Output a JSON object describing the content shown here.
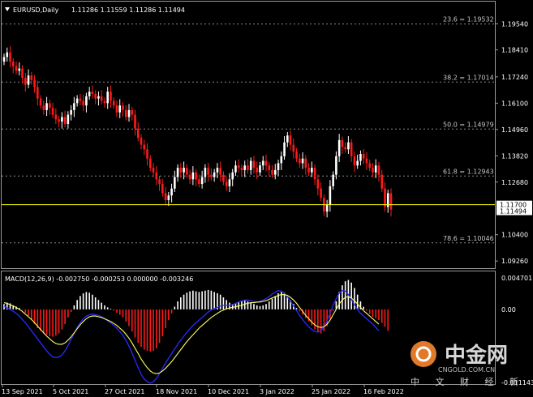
{
  "header": {
    "symbol": "EURUSD,Daily",
    "ohlc": "1.11286 1.11559 1.11286 1.11494"
  },
  "macd": {
    "label": "MACD(12,26,9) -0.002750 -0.000253 0.000000 -0.003246",
    "ticks": [
      "0.004701",
      "0.00",
      "-0.011143"
    ]
  },
  "watermark": {
    "brand": "中金网",
    "domain": "CNGOLD.COM.CN",
    "tagline": "中 文 财 经 新 媒"
  },
  "colors": {
    "background": "#000000",
    "bull": "#ffffff",
    "bear": "#ff1a1a",
    "macd_line": "#2a2aff",
    "signal_line": "#ffff66",
    "grid_level": "#8a8a8a",
    "current_price_line": "#ffff00"
  },
  "chart_data": {
    "type": "candlestick",
    "price_axis": {
      "ticks": [
        "1.19540",
        "1.18410",
        "1.17240",
        "1.16100",
        "1.14960",
        "1.13820",
        "1.12680",
        "1.10400",
        "1.09260"
      ],
      "ylim": [
        1.0895,
        1.205
      ]
    },
    "current_price": {
      "value": 1.11494,
      "label": "1.11494"
    },
    "marker_price": {
      "value": 1.117,
      "label": "1.11700"
    },
    "fibonacci_levels": [
      {
        "label": "23.6 = 1.19532",
        "value": 1.19532
      },
      {
        "label": "38.2 = 1.17014",
        "value": 1.17014
      },
      {
        "label": "50.0 = 1.14979",
        "value": 1.14979
      },
      {
        "label": "61.8 = 1.12943",
        "value": 1.12943
      },
      {
        "label": "78.6 = 1.10046",
        "value": 1.10046
      }
    ],
    "x_labels": [
      "13 Sep 2021",
      "5 Oct 2021",
      "27 Oct 2021",
      "18 Nov 2021",
      "10 Dec 2021",
      "3 Jan 2022",
      "25 Jan 2022",
      "16 Feb 2022"
    ],
    "closes": [
      1.181,
      1.183,
      1.179,
      1.177,
      1.175,
      1.176,
      1.172,
      1.169,
      1.173,
      1.171,
      1.168,
      1.163,
      1.16,
      1.158,
      1.161,
      1.159,
      1.156,
      1.154,
      1.153,
      1.155,
      1.152,
      1.156,
      1.158,
      1.161,
      1.163,
      1.162,
      1.16,
      1.164,
      1.166,
      1.165,
      1.163,
      1.164,
      1.162,
      1.161,
      1.166,
      1.162,
      1.16,
      1.157,
      1.16,
      1.158,
      1.155,
      1.158,
      1.156,
      1.15,
      1.146,
      1.143,
      1.141,
      1.137,
      1.133,
      1.131,
      1.128,
      1.126,
      1.122,
      1.119,
      1.121,
      1.124,
      1.129,
      1.133,
      1.131,
      1.133,
      1.13,
      1.128,
      1.131,
      1.128,
      1.126,
      1.129,
      1.133,
      1.13,
      1.129,
      1.131,
      1.133,
      1.13,
      1.127,
      1.125,
      1.128,
      1.131,
      1.134,
      1.133,
      1.132,
      1.134,
      1.132,
      1.136,
      1.133,
      1.131,
      1.134,
      1.136,
      1.134,
      1.132,
      1.13,
      1.132,
      1.135,
      1.138,
      1.144,
      1.147,
      1.143,
      1.14,
      1.137,
      1.135,
      1.137,
      1.133,
      1.131,
      1.133,
      1.128,
      1.124,
      1.12,
      1.114,
      1.117,
      1.125,
      1.13,
      1.138,
      1.145,
      1.142,
      1.141,
      1.144,
      1.138,
      1.134,
      1.136,
      1.139,
      1.137,
      1.135,
      1.133,
      1.131,
      1.134,
      1.13,
      1.124,
      1.116,
      1.122,
      1.1149
    ],
    "macd_hist": [
      0.0008,
      0.001,
      0.0009,
      0.0006,
      0.0004,
      0.0002,
      -0.0001,
      -0.0005,
      -0.001,
      -0.0016,
      -0.0022,
      -0.0028,
      -0.0032,
      -0.0036,
      -0.0038,
      -0.004,
      -0.0041,
      -0.0039,
      -0.0036,
      -0.003,
      -0.0022,
      -0.0012,
      -0.0004,
      0.0006,
      0.0014,
      0.002,
      0.0024,
      0.0026,
      0.0025,
      0.0022,
      0.0018,
      0.0014,
      0.001,
      0.0006,
      0.0003,
      0.0001,
      -0.0002,
      -0.0005,
      -0.0008,
      -0.0012,
      -0.0018,
      -0.0025,
      -0.0033,
      -0.0042,
      -0.005,
      -0.0056,
      -0.006,
      -0.0062,
      -0.0063,
      -0.0062,
      -0.0058,
      -0.005,
      -0.004,
      -0.0028,
      -0.0016,
      -0.0006,
      0.0004,
      0.0012,
      0.0018,
      0.0022,
      0.0025,
      0.0027,
      0.0028,
      0.0027,
      0.0026,
      0.0027,
      0.0028,
      0.0029,
      0.0028,
      0.0026,
      0.0024,
      0.0022,
      0.0018,
      0.0014,
      0.001,
      0.0008,
      0.0009,
      0.0011,
      0.0012,
      0.0013,
      0.0012,
      0.001,
      0.0008,
      0.0006,
      0.0005,
      0.0006,
      0.0008,
      0.0012,
      0.0016,
      0.002,
      0.0024,
      0.0026,
      0.0025,
      0.002,
      0.0014,
      0.0008,
      0.0002,
      -0.0003,
      -0.0008,
      -0.0013,
      -0.0018,
      -0.0024,
      -0.003,
      -0.0034,
      -0.0036,
      -0.0033,
      -0.0025,
      -0.0014,
      -0.0002,
      0.0012,
      0.0026,
      0.0036,
      0.0042,
      0.0044,
      0.004,
      0.0032,
      0.0022,
      0.0012,
      0.0004,
      -0.0002,
      -0.0007,
      -0.0011,
      -0.0013,
      -0.0016,
      -0.002,
      -0.0026,
      -0.0032
    ],
    "macd_line": [
      0.0005,
      0.0002,
      0.0,
      -0.0003,
      -0.0006,
      -0.001,
      -0.0015,
      -0.002,
      -0.0026,
      -0.0032,
      -0.0038,
      -0.0044,
      -0.005,
      -0.0056,
      -0.0062,
      -0.0067,
      -0.0071,
      -0.0072,
      -0.0071,
      -0.0068,
      -0.0062,
      -0.0054,
      -0.0045,
      -0.0036,
      -0.0027,
      -0.002,
      -0.0014,
      -0.001,
      -0.0008,
      -0.0007,
      -0.0008,
      -0.0009,
      -0.0011,
      -0.0014,
      -0.0017,
      -0.002,
      -0.0024,
      -0.0028,
      -0.0033,
      -0.0039,
      -0.0046,
      -0.0055,
      -0.0065,
      -0.0076,
      -0.0087,
      -0.0097,
      -0.0104,
      -0.0108,
      -0.011,
      -0.0108,
      -0.0103,
      -0.0096,
      -0.0088,
      -0.008,
      -0.0073,
      -0.0066,
      -0.0059,
      -0.0052,
      -0.0046,
      -0.004,
      -0.0034,
      -0.0029,
      -0.0024,
      -0.002,
      -0.0016,
      -0.0012,
      -0.0008,
      -0.0004,
      -0.0001,
      0.0001,
      0.0003,
      0.0005,
      0.0006,
      0.0006,
      0.0006,
      0.0007,
      0.0009,
      0.0011,
      0.0013,
      0.0014,
      0.0014,
      0.0013,
      0.0012,
      0.0011,
      0.0012,
      0.0014,
      0.0016,
      0.0019,
      0.0023,
      0.0026,
      0.0028,
      0.0027,
      0.0024,
      0.0019,
      0.0012,
      0.0005,
      -0.0002,
      -0.0009,
      -0.0015,
      -0.0021,
      -0.0026,
      -0.003,
      -0.0033,
      -0.0034,
      -0.0032,
      -0.0026,
      -0.0017,
      -0.0006,
      0.0006,
      0.0016,
      0.0024,
      0.0028,
      0.0027,
      0.0022,
      0.0015,
      0.0007,
      0.0,
      -0.0006,
      -0.001,
      -0.0014,
      -0.0018,
      -0.0022,
      -0.0027,
      -0.0032
    ],
    "signal_line": [
      0.001,
      0.0009,
      0.0007,
      0.0005,
      0.0003,
      0.0,
      -0.0003,
      -0.0007,
      -0.0011,
      -0.0015,
      -0.002,
      -0.0025,
      -0.003,
      -0.0035,
      -0.004,
      -0.0044,
      -0.0048,
      -0.0051,
      -0.0052,
      -0.0052,
      -0.005,
      -0.0046,
      -0.0041,
      -0.0035,
      -0.0029,
      -0.0023,
      -0.0018,
      -0.0014,
      -0.0011,
      -0.001,
      -0.001,
      -0.0011,
      -0.0012,
      -0.0014,
      -0.0016,
      -0.0018,
      -0.0021,
      -0.0024,
      -0.0028,
      -0.0032,
      -0.0037,
      -0.0043,
      -0.005,
      -0.0058,
      -0.0066,
      -0.0074,
      -0.0081,
      -0.0087,
      -0.0092,
      -0.0095,
      -0.0096,
      -0.0095,
      -0.0092,
      -0.0088,
      -0.0083,
      -0.0078,
      -0.0072,
      -0.0066,
      -0.006,
      -0.0054,
      -0.0048,
      -0.0043,
      -0.0038,
      -0.0033,
      -0.0028,
      -0.0024,
      -0.002,
      -0.0016,
      -0.0012,
      -0.0009,
      -0.0006,
      -0.0003,
      -0.0001,
      0.0001,
      0.0002,
      0.0003,
      0.0004,
      0.0005,
      0.0006,
      0.0008,
      0.0009,
      0.001,
      0.001,
      0.0011,
      0.0011,
      0.0012,
      0.0013,
      0.0015,
      0.0017,
      0.0019,
      0.0021,
      0.0022,
      0.0022,
      0.0021,
      0.0018,
      0.0014,
      0.0009,
      0.0003,
      -0.0003,
      -0.0009,
      -0.0014,
      -0.0019,
      -0.0023,
      -0.0026,
      -0.0027,
      -0.0026,
      -0.0022,
      -0.0016,
      -0.0008,
      0.0,
      0.0008,
      0.0014,
      0.0018,
      0.0019,
      0.0017,
      0.0013,
      0.0008,
      0.0003,
      -0.0002,
      -0.0006,
      -0.001,
      -0.0014,
      -0.0018,
      -0.0022
    ]
  }
}
